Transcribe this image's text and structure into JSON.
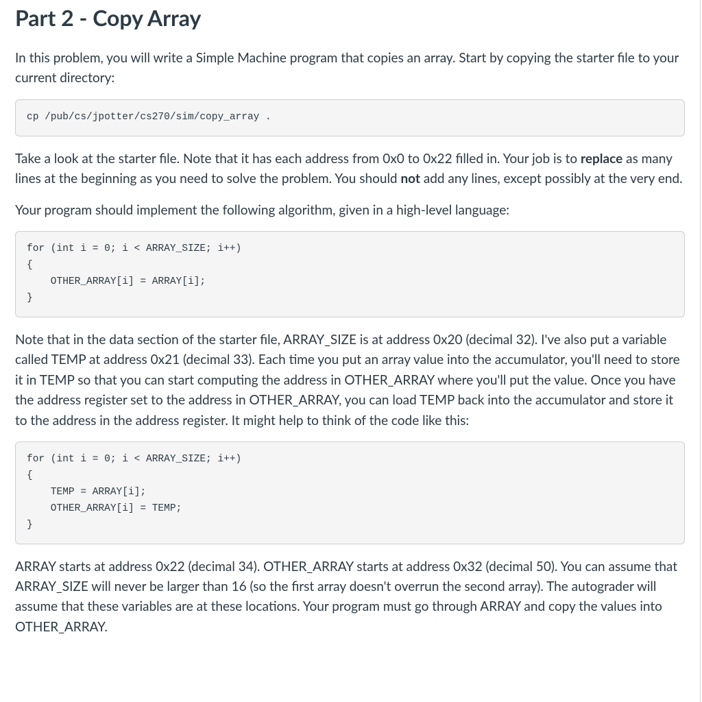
{
  "heading": "Part 2 - Copy Array",
  "p1_a": "In this problem, you will write a Simple Machine program that copies an array. Start by copying the starter file to your current directory:",
  "code1": "cp /pub/cs/jpotter/cs270/sim/copy_array .",
  "p2_a": "Take a look at the starter file. Note that it has each address from 0x0 to 0x22 filled in. Your job is to ",
  "p2_b": "replace",
  "p2_c": " as many lines at the beginning as you need to solve the problem. You should ",
  "p2_d": "not",
  "p2_e": " add any lines, except possibly at the very end.",
  "p3": "Your program should implement the following algorithm, given in a high-level language:",
  "code2": "for (int i = 0; i < ARRAY_SIZE; i++)\n{\n    OTHER_ARRAY[i] = ARRAY[i];\n}",
  "p4": "Note that in the data section of the starter file, ARRAY_SIZE is at address 0x20 (decimal 32). I've also put a variable called TEMP at address 0x21 (decimal 33). Each time you put an array value into the accumulator, you'll need to store it in TEMP so that you can start computing the address in OTHER_ARRAY where you'll put the value. Once you have the address register set to the address in OTHER_ARRAY, you can load TEMP back into the accumulator and store it to the address in the address register. It might help to think of the code like this:",
  "code3": "for (int i = 0; i < ARRAY_SIZE; i++)\n{\n    TEMP = ARRAY[i];\n    OTHER_ARRAY[i] = TEMP;\n}",
  "p5": "ARRAY starts at address 0x22 (decimal 34). OTHER_ARRAY starts at address 0x32 (decimal 50). You can assume that ARRAY_SIZE will never be larger than 16 (so the first array doesn't overrun the second array). The autograder will assume that these variables are at these locations. Your program must go through ARRAY and copy the values into OTHER_ARRAY."
}
